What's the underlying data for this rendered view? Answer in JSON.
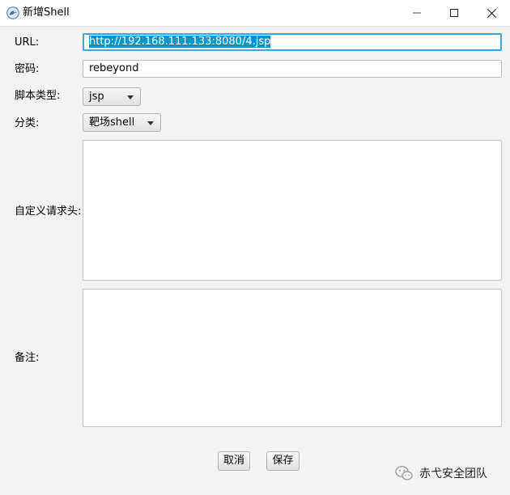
{
  "window": {
    "title": "新增Shell",
    "minimize_icon": "minimize-icon",
    "maximize_icon": "maximize-icon",
    "close_icon": "close-icon"
  },
  "form": {
    "url_label": "URL:",
    "url_value": "http://192.168.111.133:8080/4.jsp",
    "password_label": "密码:",
    "password_value": "rebeyond",
    "script_type_label": "脚本类型:",
    "script_type_value": "jsp",
    "category_label": "分类:",
    "category_value": "靶场shell",
    "custom_headers_label": "自定义请求头:",
    "custom_headers_value": "",
    "notes_label": "备注:",
    "notes_value": ""
  },
  "buttons": {
    "cancel": "取消",
    "save": "保存"
  },
  "watermark": {
    "text": "赤弋安全团队",
    "icon": "wechat-icon"
  },
  "colors": {
    "focus_border": "#39a8de",
    "selection": "#0096c9"
  }
}
